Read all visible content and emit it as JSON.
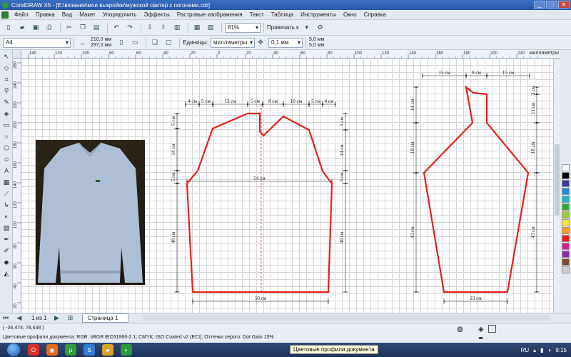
{
  "window": {
    "title": "CorelDRAW X5 - [E:\\вязание\\мои выкройки\\мужской свитер с погонами.cdr]",
    "buttons": [
      "_",
      "□",
      "✕"
    ]
  },
  "menu": [
    "Файл",
    "Правка",
    "Вид",
    "Макет",
    "Упорядочить",
    "Эффекты",
    "Растровые изображения",
    "Текст",
    "Таблица",
    "Инструменты",
    "Окно",
    "Справка"
  ],
  "toolbar": {
    "zoom": "81%",
    "snap_label": "Привязать к"
  },
  "property_bar": {
    "page_size": "A4",
    "width": "210,0 мм",
    "height": "297,0 мм",
    "units_label": "Единицы:",
    "units_value": "миллиметры",
    "nudge": "0,1 мм",
    "dup_x": "5,0 мм",
    "dup_y": "5,0 мм"
  },
  "rulers": {
    "h_unit": "миллиметры",
    "v_unit": "миллиметры",
    "h_ticks": [
      "140",
      "120",
      "100",
      "80",
      "60",
      "40",
      "20",
      "0",
      "20",
      "40",
      "60",
      "80",
      "100",
      "120",
      "140",
      "160",
      "180",
      "200",
      "220"
    ],
    "v_ticks": [
      "260",
      "240",
      "220",
      "200",
      "180",
      "160",
      "140",
      "120",
      "100",
      "80",
      "60",
      "40",
      "20"
    ]
  },
  "pattern": {
    "body_top": [
      "4 см",
      "5 см",
      "13 см",
      "5 см",
      "8 см",
      "10 см",
      "5 см",
      "4 см"
    ],
    "body_left": [
      "6 см",
      "14 см",
      "5 см",
      "40 см"
    ],
    "body_right": [
      "5 см",
      "14 см",
      "5 см",
      "40 см"
    ],
    "body_mid": "54 см",
    "body_bottom": "50 см",
    "sleeve_top": [
      "15 см",
      "8 см",
      "15 см"
    ],
    "sleeve_left": [
      "14 см",
      "18 см",
      "43 см"
    ],
    "sleeve_right": [
      "3 см",
      "11 см",
      "18 см",
      "43 см"
    ],
    "sleeve_bottom": "23 см"
  },
  "pages": {
    "counter": "1 из 1",
    "tab": "Страница 1"
  },
  "status": {
    "coords": "( -36,474; 78,638 )",
    "profile": "Цветовые профили документа: RGB: sRGB IEC61966-2.1; CMYK: ISO Coated v2 (ECI); Оттенки серого: Dot Gain 15%",
    "tooltip": "Цветовые профили документа"
  },
  "taskbar": {
    "lang": "RU",
    "time": "9:15"
  },
  "colors": {
    "outline": "#e8201e",
    "palette": [
      "#ffffff",
      "#000000",
      "#3a3aa8",
      "#1f8de0",
      "#20b7c4",
      "#2faa3a",
      "#9ccc3a",
      "#f5e23a",
      "#f39a1f",
      "#e8201e",
      "#d6208c",
      "#8a2aa8",
      "#7a4a2a",
      "#cccccc"
    ]
  }
}
